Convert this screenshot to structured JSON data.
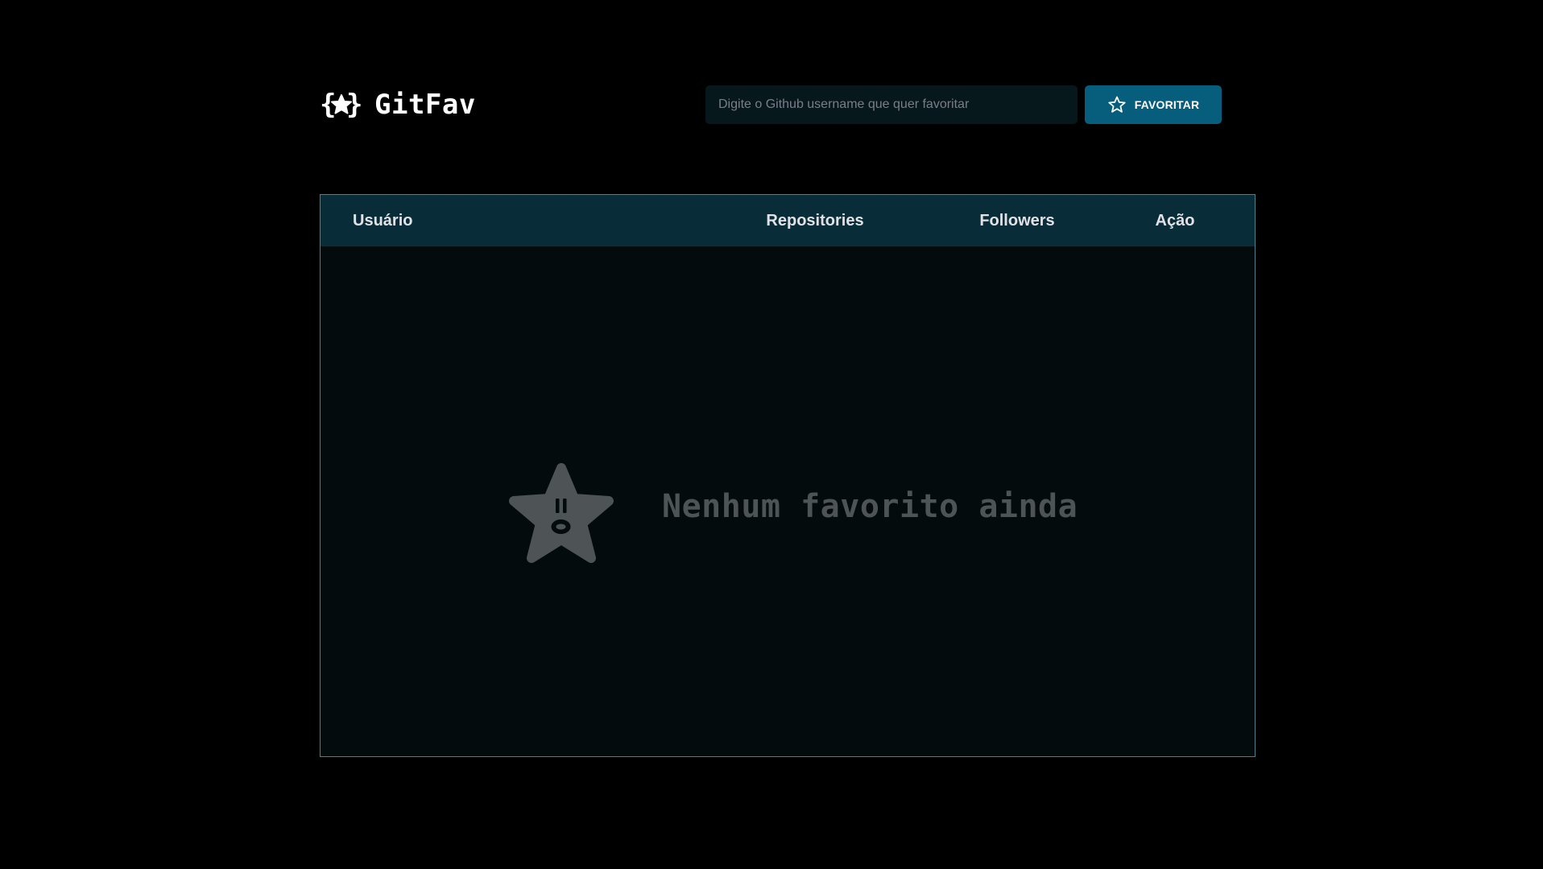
{
  "header": {
    "logo_text": "GitFav",
    "logo_icon": "braces-star-icon",
    "search": {
      "placeholder": "Digite o Github username que quer favoritar",
      "value": ""
    },
    "favorite_button": {
      "label": "FAVORITAR",
      "icon": "star-outline-icon"
    }
  },
  "table": {
    "columns": [
      "Usuário",
      "Repositories",
      "Followers",
      "Ação"
    ],
    "rows": []
  },
  "empty_state": {
    "icon": "surprised-star-icon",
    "message": "Nenhum favorito ainda"
  },
  "colors": {
    "background": "#000000",
    "input_bg": "#06181c",
    "accent": "#065e7c",
    "table_header_bg": "#092d38",
    "table_border": "#4a808c",
    "table_body_bg": "#030b0d",
    "empty_text": "#4e5455",
    "empty_icon": "#4e5455"
  }
}
